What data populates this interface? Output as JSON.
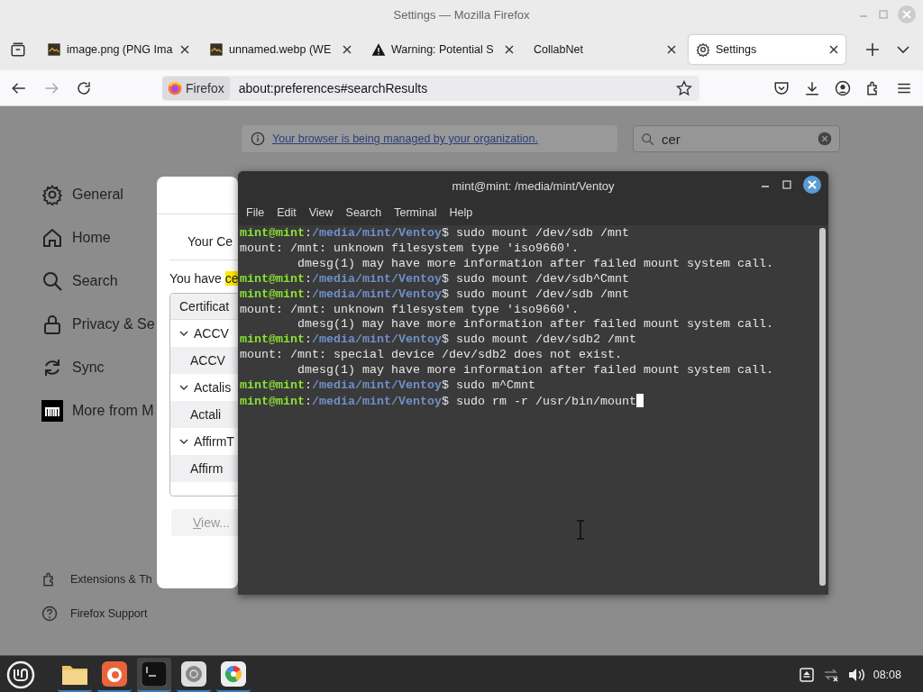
{
  "window": {
    "title": "Settings — Mozilla Firefox"
  },
  "tabs": [
    {
      "label": "image.png (PNG Ima",
      "selected": false
    },
    {
      "label": "unnamed.webp (WE",
      "selected": false
    },
    {
      "label": "Warning: Potential S",
      "selected": false
    },
    {
      "label": "CollabNet",
      "selected": false
    },
    {
      "label": "Settings",
      "selected": true
    }
  ],
  "toolbar": {
    "identity": "Firefox",
    "url": "about:preferences#searchResults"
  },
  "preferences": {
    "notice": "Your browser is being managed by your organization.",
    "search": {
      "value": "cer"
    },
    "sidebar": [
      "General",
      "Home",
      "Search",
      "Privacy & Se",
      "Sync",
      "More from M"
    ],
    "footer_links": [
      "Extensions & Th",
      "Firefox Support"
    ]
  },
  "dialog": {
    "heading": "Your Ce",
    "intro": {
      "text": "You have",
      "highlight": "ce"
    },
    "tree_header": "Certificat",
    "groups": [
      {
        "label": "ACCV",
        "expanded": true,
        "children": [
          {
            "label": "ACCV"
          }
        ]
      },
      {
        "label": "Actalis",
        "expanded": true,
        "children": [
          {
            "label": "Actali"
          }
        ]
      },
      {
        "label": "AffirmT",
        "expanded": true,
        "children": [
          {
            "label": "Affirm"
          }
        ]
      }
    ],
    "button": "View..."
  },
  "terminal": {
    "title": "mint@mint: /media/mint/Ventoy",
    "menu": [
      "File",
      "Edit",
      "View",
      "Search",
      "Terminal",
      "Help"
    ],
    "lines": [
      {
        "kind": "prompt",
        "user": "mint@mint",
        "separator": ":",
        "path": "/media/mint/Ventoy",
        "symbol": "$",
        "command": "sudo mount /dev/sdb /mnt"
      },
      {
        "kind": "output",
        "text": "mount: /mnt: unknown filesystem type 'iso9660'."
      },
      {
        "kind": "continuation",
        "text": "dmesg(1) may have more information after failed mount system call."
      },
      {
        "kind": "prompt",
        "user": "mint@mint",
        "separator": ":",
        "path": "/media/mint/Ventoy",
        "symbol": "$",
        "command": "sudo mount /dev/sdb^Cmnt"
      },
      {
        "kind": "prompt",
        "user": "mint@mint",
        "separator": ":",
        "path": "/media/mint/Ventoy",
        "symbol": "$",
        "command": "sudo mount /dev/sdb /mnt"
      },
      {
        "kind": "output",
        "text": "mount: /mnt: unknown filesystem type 'iso9660'."
      },
      {
        "kind": "continuation",
        "text": "dmesg(1) may have more information after failed mount system call."
      },
      {
        "kind": "prompt",
        "user": "mint@mint",
        "separator": ":",
        "path": "/media/mint/Ventoy",
        "symbol": "$",
        "command": "sudo mount /dev/sdb2 /mnt"
      },
      {
        "kind": "output",
        "text": "mount: /mnt: special device /dev/sdb2 does not exist."
      },
      {
        "kind": "continuation",
        "text": "dmesg(1) may have more information after failed mount system call."
      },
      {
        "kind": "prompt",
        "user": "mint@mint",
        "separator": ":",
        "path": "/media/mint/Ventoy",
        "symbol": "$",
        "command": "sudo m^Cmnt"
      },
      {
        "kind": "prompt",
        "user": "mint@mint",
        "separator": ":",
        "path": "/media/mint/Ventoy",
        "symbol": "$",
        "command": "sudo rm -r /usr/bin/mount",
        "cursor": true
      }
    ]
  },
  "taskbar": {
    "apps": [
      {
        "selected": false
      },
      {
        "selected": false
      },
      {
        "selected": true
      },
      {
        "selected": false
      },
      {
        "selected": false
      }
    ],
    "clock": "08:08"
  }
}
